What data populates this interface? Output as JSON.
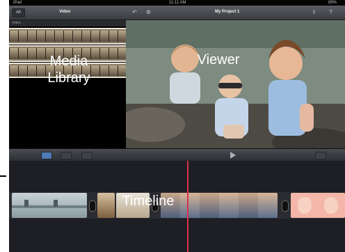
{
  "statusbar": {
    "carrier": "iPad",
    "clock": "11:11 AM",
    "battery": "89%"
  },
  "toolbar": {
    "back_label": "All",
    "media_title": "Video",
    "project_title": "My Project 1"
  },
  "media_library": {
    "header": "Video"
  },
  "labels": {
    "media_library": "Media\nLibrary",
    "viewer": "Viewer",
    "timeline": "Timeline"
  },
  "colors": {
    "playhead": "#d9304a",
    "active_tool": "#4f7bb6"
  },
  "icons": [
    "undo-icon",
    "settings-icon",
    "share-icon",
    "help-icon",
    "play-icon",
    "microphone-icon",
    "camera-icon"
  ]
}
